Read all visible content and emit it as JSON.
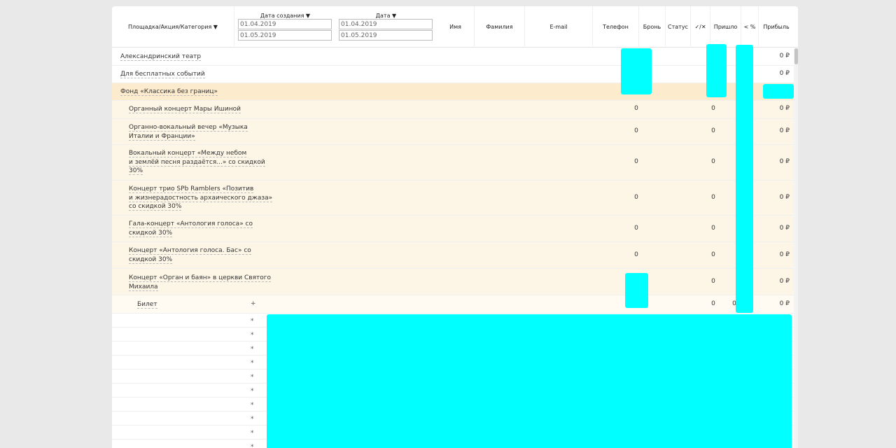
{
  "header": {
    "venue_col": "Площадка/Акция/Категория ▼",
    "created_label": "Дата создания ▼",
    "created_from": "01.04.2019",
    "created_to": "01.05.2019",
    "date_label": "Дата ▼",
    "date_from": "01.04.2019",
    "date_to": "01.05.2019",
    "first_name": "Имя",
    "last_name": "Фамилия",
    "email": "E-mail",
    "phone": "Телефон",
    "booking": "Бронь",
    "status": "Статус",
    "check": "✓/✕",
    "came": "Пришло",
    "percent": "< %",
    "profit": "Прибыль"
  },
  "rows": {
    "r0": {
      "label": "Александринский театр",
      "profit": "0 ₽"
    },
    "r1": {
      "label": "Для бесплатных событий",
      "profit": "0 ₽"
    },
    "r2": {
      "label": "Фонд «Классика без границ»"
    },
    "r3": {
      "label": "Органный концерт Мары Ишиной",
      "booking": "0",
      "came": "0",
      "profit": "0 ₽"
    },
    "r4": {
      "l1": "Органно-вокальный вечер «Музыка",
      "l2": "Италии и Франции»",
      "booking": "0",
      "came": "0",
      "profit": "0 ₽"
    },
    "r5": {
      "l1": "Вокальный концерт «Между небом",
      "l2": "и землёй песня раздаётся...» со скидкой",
      "l3": "30%",
      "booking": "0",
      "came": "0",
      "profit": "0 ₽"
    },
    "r6": {
      "l1": "Концерт трио SPb Ramblers «Позитив",
      "l2": "и жизнерадостность архаического джаза»",
      "l3": "со скидкой 30%",
      "booking": "0",
      "came": "0",
      "profit": "0 ₽"
    },
    "r7": {
      "l1": "Гала-концерт «Антология голоса» со",
      "l2": "скидкой 30%",
      "booking": "0",
      "came": "0",
      "profit": "0 ₽"
    },
    "r8": {
      "l1": "Концерт «Антология голоса. Бас» со",
      "l2": "скидкой 30%",
      "booking": "0",
      "came": "0",
      "profit": "0 ₽"
    },
    "r9": {
      "l1": "Концерт «Орган и баян» в церкви Святого",
      "l2": "Михаила",
      "came": "0",
      "profit": "0 ₽"
    },
    "r10": {
      "label": "Билет",
      "plus": "+",
      "came": "0",
      "percent": "0",
      "profit": "0 ₽"
    }
  },
  "star_symbol": "*",
  "colors": {
    "fund_row": "#fdebcd",
    "sub_row": "#fdf5e6",
    "redaction": "#00ffff"
  }
}
